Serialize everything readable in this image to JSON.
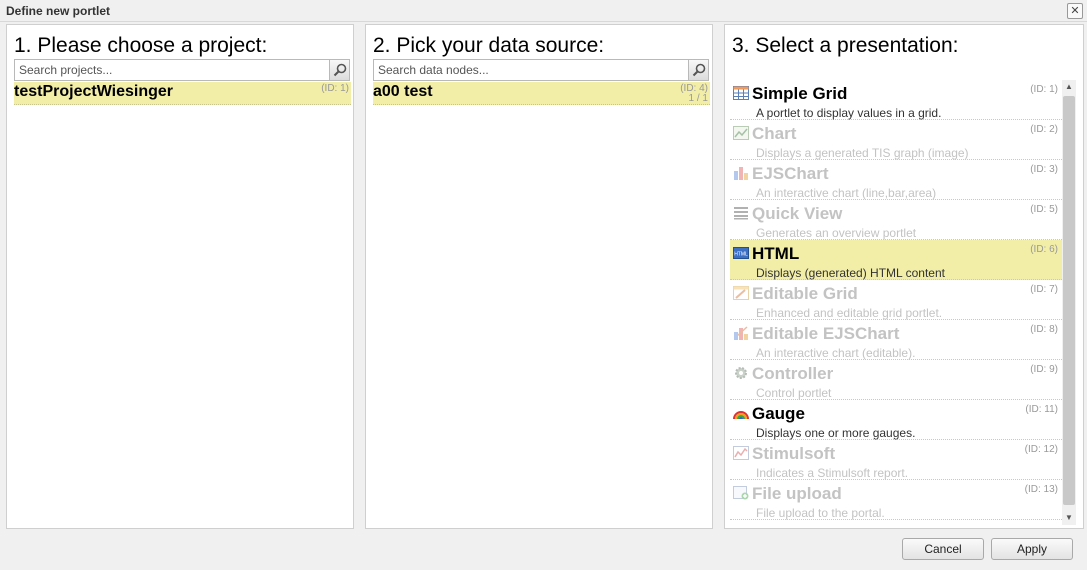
{
  "window": {
    "title": "Define new portlet",
    "close_glyph": "✕"
  },
  "projects": {
    "heading": "1. Please choose a project:",
    "search_placeholder": "Search projects...",
    "items": [
      {
        "name": "testProjectWiesinger",
        "id": "(ID: 1)"
      }
    ]
  },
  "datasource": {
    "heading": "2. Pick your data source:",
    "search_placeholder": "Search data nodes...",
    "items": [
      {
        "name": "a00 test",
        "id": "(ID: 4)",
        "count": "1 / 1"
      }
    ]
  },
  "presentation": {
    "heading": "3. Select a presentation:",
    "items": [
      {
        "name": "Simple Grid",
        "desc": "A portlet to display values in a grid.",
        "id": "(ID: 1)",
        "icon": "grid-icon",
        "state": "enabled"
      },
      {
        "name": "Chart",
        "desc": "Displays a generated TIS graph (image)",
        "id": "(ID: 2)",
        "icon": "image-chart-icon",
        "state": "disabled"
      },
      {
        "name": "EJSChart",
        "desc": "An interactive chart (line,bar,area)",
        "id": "(ID: 3)",
        "icon": "bar-chart-icon",
        "state": "disabled"
      },
      {
        "name": "Quick View",
        "desc": "Generates an overview portlet",
        "id": "(ID: 5)",
        "icon": "list-icon",
        "state": "disabled"
      },
      {
        "name": "HTML",
        "desc": "Displays (generated) HTML content",
        "id": "(ID: 6)",
        "icon": "html-icon",
        "state": "selected"
      },
      {
        "name": "Editable Grid",
        "desc": "Enhanced and editable grid portlet.",
        "id": "(ID: 7)",
        "icon": "edit-grid-icon",
        "state": "disabled"
      },
      {
        "name": "Editable EJSChart",
        "desc": "An interactive chart (editable).",
        "id": "(ID: 8)",
        "icon": "edit-chart-icon",
        "state": "disabled"
      },
      {
        "name": "Controller",
        "desc": "Control portlet",
        "id": "(ID: 9)",
        "icon": "gear-icon",
        "state": "disabled"
      },
      {
        "name": "Gauge",
        "desc": "Displays one or more gauges.",
        "id": "(ID: 11)",
        "icon": "rainbow-icon",
        "state": "enabled"
      },
      {
        "name": "Stimulsoft",
        "desc": "Indicates a Stimulsoft report.",
        "id": "(ID: 12)",
        "icon": "report-icon",
        "state": "disabled"
      },
      {
        "name": "File upload",
        "desc": "File upload to the portal.",
        "id": "(ID: 13)",
        "icon": "upload-icon",
        "state": "disabled"
      }
    ]
  },
  "buttons": {
    "cancel": "Cancel",
    "apply": "Apply"
  },
  "colors": {
    "selection": "#f2eea8",
    "disabled_text": "#c3c3c3",
    "id_text": "#999999"
  }
}
